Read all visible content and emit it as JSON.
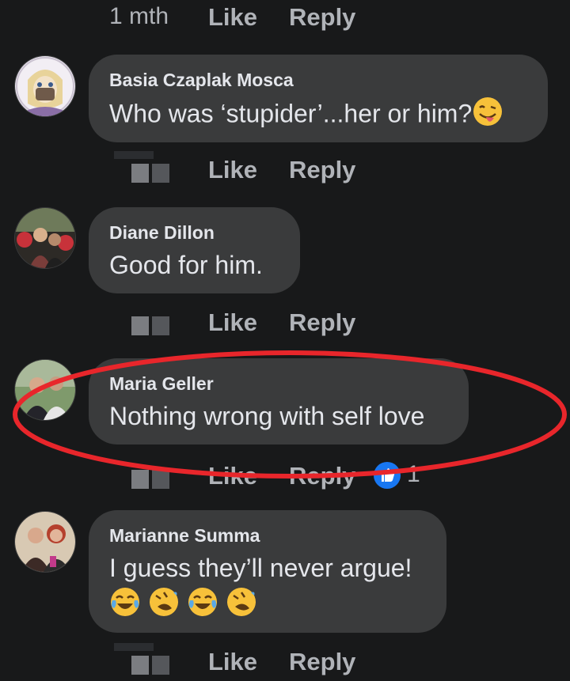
{
  "rows": {
    "top": {
      "time": "1 mth",
      "like": "Like",
      "reply": "Reply"
    },
    "c1": {
      "like": "Like",
      "reply": "Reply"
    },
    "c2": {
      "like": "Like",
      "reply": "Reply"
    },
    "c3": {
      "like": "Like",
      "reply": "Reply",
      "reaction_count": "1"
    },
    "c4": {
      "like": "Like",
      "reply": "Reply"
    }
  },
  "comments": [
    {
      "author": "Basia Czaplak Mosca",
      "text": "Who was ‘stupider’...her or him?",
      "emoji": "winking-tongue-emoji"
    },
    {
      "author": "Diane Dillon",
      "text": "Good for him."
    },
    {
      "author": "Maria Geller",
      "text": "Nothing wrong with self love"
    },
    {
      "author": "Marianne Summa",
      "text": "I guess they’ll never argue!",
      "emojis": [
        "tears-of-joy-emoji",
        "rolling-laughing-emoji",
        "tears-of-joy-emoji",
        "rolling-laughing-emoji"
      ]
    }
  ],
  "colors": {
    "background": "#18191a",
    "bubble": "#3a3b3c",
    "muted_text": "#b0b3b8",
    "highlight": "#e8262b",
    "reaction_blue": "#1877f2"
  }
}
